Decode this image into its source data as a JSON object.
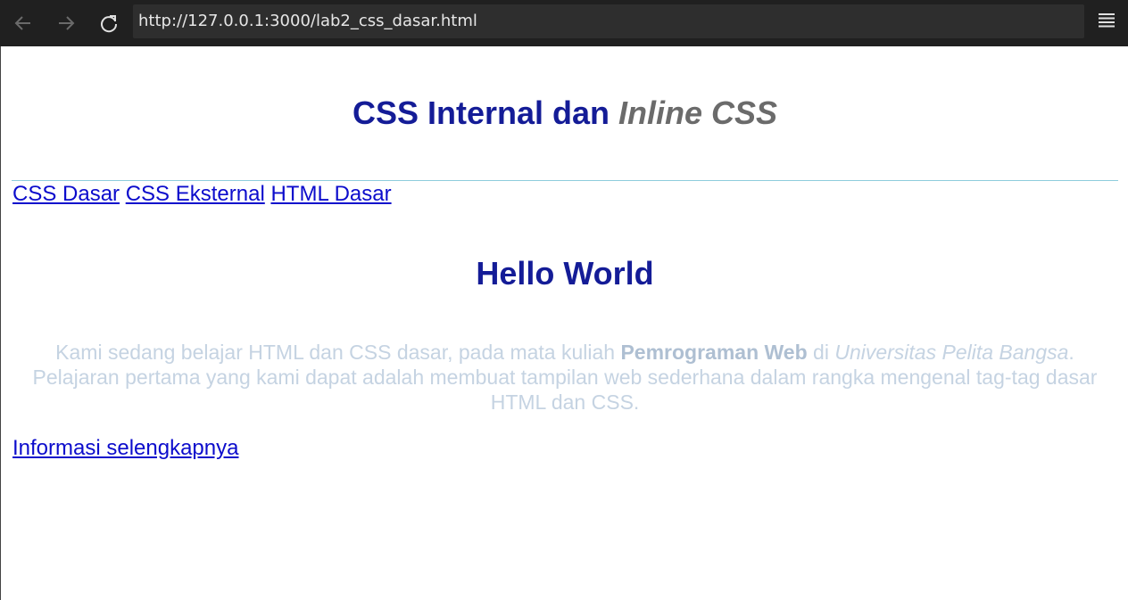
{
  "browser": {
    "url": "http://127.0.0.1:3000/lab2_css_dasar.html",
    "icons": [
      "back-arrow-icon",
      "forward-arrow-icon",
      "reload-icon",
      "hamburger-menu-icon"
    ]
  },
  "page": {
    "title_main": "CSS Internal dan ",
    "title_italic": "Inline CSS",
    "nav_links": [
      "CSS Dasar",
      "CSS Eksternal",
      "HTML Dasar"
    ],
    "heading": "Hello World",
    "intro": {
      "part1": "Kami sedang belajar HTML dan CSS dasar, pada mata kuliah ",
      "bold": "Pemrograman Web",
      "part2": " di ",
      "italic": "Universitas Pelita Bangsa",
      "part3": ". Pelajaran pertama yang kami dapat adalah membuat tampilan web sederhana dalam rangka mengenal tag-tag dasar HTML dan CSS."
    },
    "more_link": "Informasi selengkapnya"
  },
  "colors": {
    "heading": "#141c97",
    "italic_title": "#6b6b6b",
    "link": "#0c0ccc",
    "intro_text": "#c5d3e2",
    "divider": "#8ecddc",
    "toolbar": "#202020"
  }
}
